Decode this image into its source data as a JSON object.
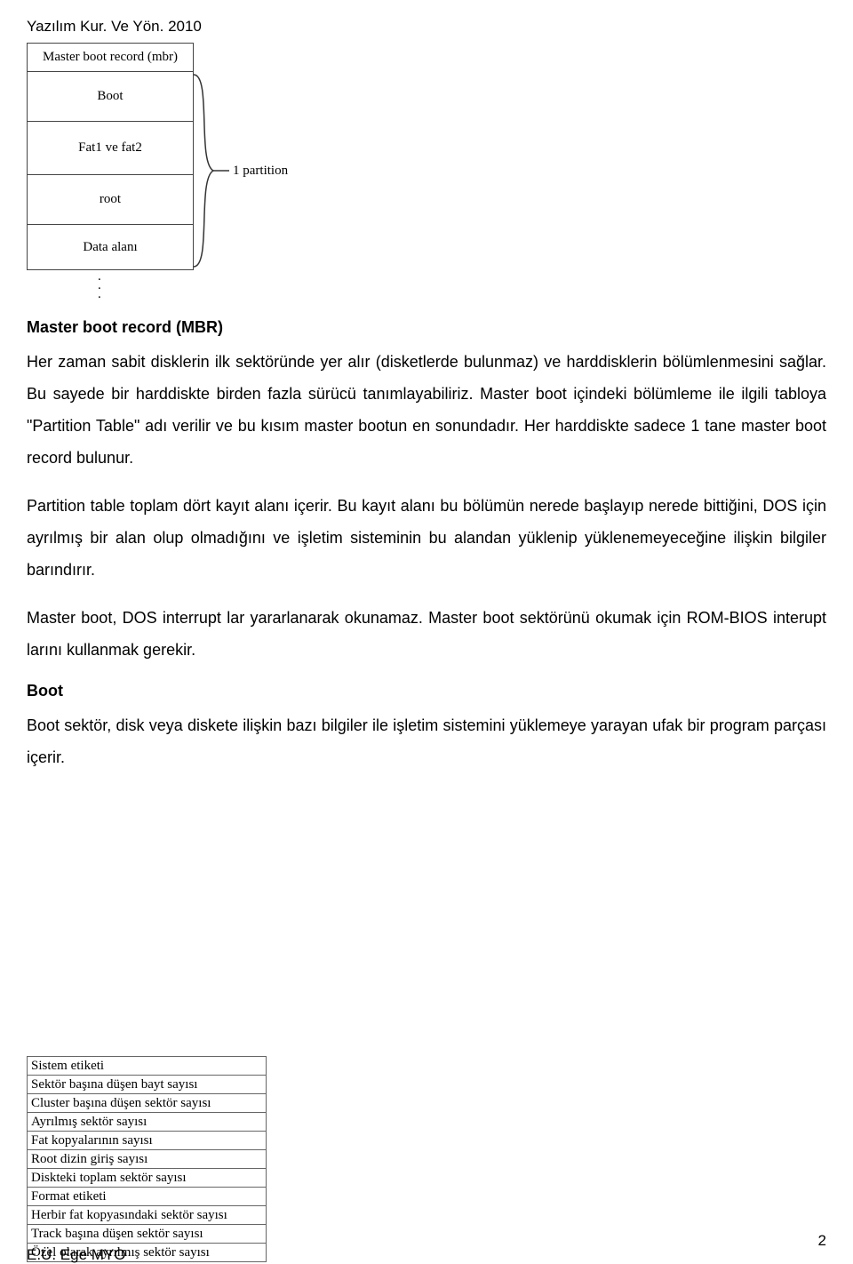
{
  "header": "Yazılım Kur. Ve Yön. 2010",
  "diagram1": {
    "cells": [
      "Master boot record (mbr)",
      "Boot",
      "Fat1 ve fat2",
      "root",
      "Data alanı"
    ],
    "dots": ".\n.\n.",
    "brace_label": "1 partition"
  },
  "mbr": {
    "heading": "Master boot record (MBR)",
    "p1": "Her zaman sabit disklerin ilk sektöründe yer alır (disketlerde bulunmaz) ve harddisklerin bölümlenmesini sağlar. Bu sayede bir harddiskte birden fazla sürücü tanımlayabiliriz. Master boot içindeki bölümleme ile ilgili tabloya \"Partition Table\" adı verilir ve bu kısım master bootun en sonundadır. Her harddiskte sadece 1 tane master boot record bulunur.",
    "p2": "Partition table toplam dört kayıt alanı içerir. Bu kayıt alanı bu bölümün nerede başlayıp nerede bittiğini, DOS için ayrılmış bir alan olup olmadığını ve işletim sisteminin bu alandan yüklenip yüklenemeyeceğine ilişkin bilgiler barındırır.",
    "p3": "Master boot, DOS interrupt lar yararlanarak okunamaz. Master boot sektörünü okumak için ROM-BIOS interupt larını kullanmak gerekir."
  },
  "boot": {
    "heading": "Boot",
    "p1": "Boot sektör, disk veya diskete ilişkin bazı bilgiler ile işletim sistemini yüklemeye yarayan ufak bir program parçası içerir.",
    "table": [
      "Sistem etiketi",
      "Sektör başına düşen bayt sayısı",
      "Cluster başına düşen sektör sayısı",
      "Ayrılmış sektör sayısı",
      "Fat kopyalarının sayısı",
      "Root dizin giriş sayısı",
      "Diskteki toplam sektör sayısı",
      "Format etiketi",
      "Herbir fat kopyasındaki sektör sayısı",
      "Track başına düşen sektör sayısı",
      "Özel olarak ayrılmış sektör sayısı"
    ]
  },
  "footer_left": "E.Ü. Ege MYO",
  "page_number": "2"
}
